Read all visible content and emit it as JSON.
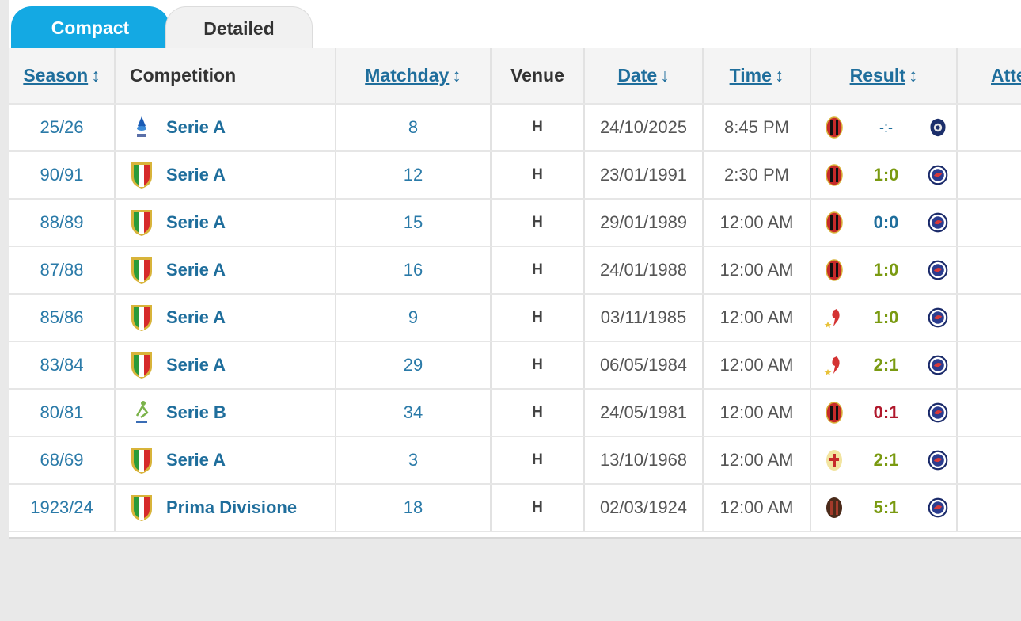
{
  "tabs": {
    "compact": "Compact",
    "detailed": "Detailed"
  },
  "headers": {
    "season": "Season",
    "competition": "Competition",
    "matchday": "Matchday",
    "venue": "Venue",
    "date": "Date",
    "time": "Time",
    "result": "Result",
    "attendance": "Attendance",
    "sort_icon": "↕",
    "sort_desc_icon": "↓"
  },
  "colors": {
    "win": "#7a9a11",
    "draw": "#1f6e9c",
    "loss": "#b0182c",
    "accent": "#14a9e3",
    "link": "#1f6e9c"
  },
  "rows": [
    {
      "season": "25/26",
      "competition": "Serie A",
      "logo": "serie-a-new-logo-icon",
      "matchday": "8",
      "venue": "H",
      "date": "24/10/2025",
      "time": "8:45 PM",
      "result": "-:-",
      "status": "pending",
      "home_crest": "ac-milan-crest-icon",
      "away_crest": "opponent-crest-icon"
    },
    {
      "season": "90/91",
      "competition": "Serie A",
      "logo": "scudetto-shield-icon",
      "matchday": "12",
      "venue": "H",
      "date": "23/01/1991",
      "time": "2:30 PM",
      "result": "1:0",
      "status": "win",
      "home_crest": "ac-milan-crest-icon",
      "away_crest": "opponent-crest-icon"
    },
    {
      "season": "88/89",
      "competition": "Serie A",
      "logo": "scudetto-shield-icon",
      "matchday": "15",
      "venue": "H",
      "date": "29/01/1989",
      "time": "12:00 AM",
      "result": "0:0",
      "status": "draw",
      "home_crest": "ac-milan-crest-icon",
      "away_crest": "opponent-crest-icon"
    },
    {
      "season": "87/88",
      "competition": "Serie A",
      "logo": "scudetto-shield-icon",
      "matchday": "16",
      "venue": "H",
      "date": "24/01/1988",
      "time": "12:00 AM",
      "result": "1:0",
      "status": "win",
      "home_crest": "ac-milan-crest-icon",
      "away_crest": "opponent-crest-icon"
    },
    {
      "season": "85/86",
      "competition": "Serie A",
      "logo": "scudetto-shield-icon",
      "matchday": "9",
      "venue": "H",
      "date": "03/11/1985",
      "time": "12:00 AM",
      "result": "1:0",
      "status": "win",
      "home_crest": "devil-crest-icon",
      "away_crest": "opponent-crest-icon"
    },
    {
      "season": "83/84",
      "competition": "Serie A",
      "logo": "scudetto-shield-icon",
      "matchday": "29",
      "venue": "H",
      "date": "06/05/1984",
      "time": "12:00 AM",
      "result": "2:1",
      "status": "win",
      "home_crest": "devil-crest-icon",
      "away_crest": "opponent-crest-icon"
    },
    {
      "season": "80/81",
      "competition": "Serie B",
      "logo": "serie-b-logo-icon",
      "matchday": "34",
      "venue": "H",
      "date": "24/05/1981",
      "time": "12:00 AM",
      "result": "0:1",
      "status": "loss",
      "home_crest": "ac-milan-crest-icon",
      "away_crest": "opponent-crest-icon"
    },
    {
      "season": "68/69",
      "competition": "Serie A",
      "logo": "scudetto-shield-icon",
      "matchday": "3",
      "venue": "H",
      "date": "13/10/1968",
      "time": "12:00 AM",
      "result": "2:1",
      "status": "win",
      "home_crest": "milan-cross-crest-icon",
      "away_crest": "opponent-crest-icon"
    },
    {
      "season": "1923/24",
      "competition": "Prima Divisione",
      "logo": "scudetto-shield-icon",
      "matchday": "18",
      "venue": "H",
      "date": "02/03/1924",
      "time": "12:00 AM",
      "result": "5:1",
      "status": "win",
      "home_crest": "old-milan-crest-icon",
      "away_crest": "opponent-crest-icon"
    }
  ]
}
